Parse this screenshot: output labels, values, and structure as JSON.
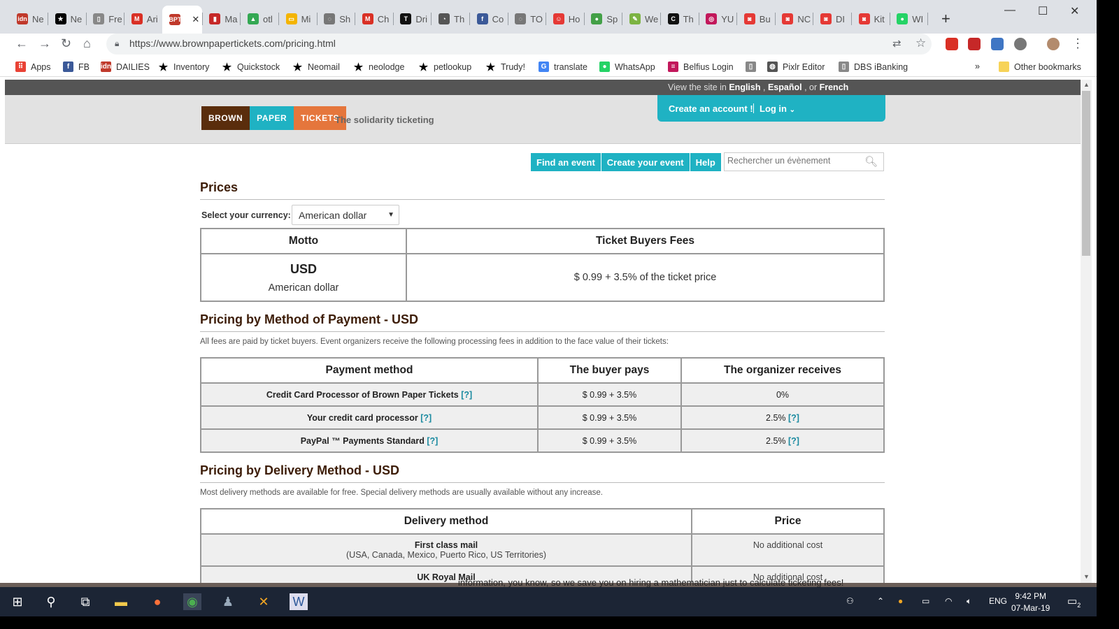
{
  "browser": {
    "tabs": [
      {
        "label": "Ne",
        "color": "#c0392b",
        "glyph": "idn"
      },
      {
        "label": "Ne",
        "color": "#000",
        "glyph": "★"
      },
      {
        "label": "Fre",
        "color": "#888",
        "glyph": "▯"
      },
      {
        "label": "Ari",
        "color": "#d93025",
        "glyph": "M"
      },
      {
        "label": "",
        "color": "#c0392b",
        "glyph": "BPT",
        "active": true
      },
      {
        "label": "Ma",
        "color": "#c62828",
        "glyph": "▮"
      },
      {
        "label": "otl",
        "color": "#34a853",
        "glyph": "▲"
      },
      {
        "label": "Mi",
        "color": "#f4b400",
        "glyph": "▭"
      },
      {
        "label": "Sh",
        "color": "#777",
        "glyph": "◌"
      },
      {
        "label": "Ch",
        "color": "#d93025",
        "glyph": "M"
      },
      {
        "label": "Dri",
        "color": "#111",
        "glyph": "T"
      },
      {
        "label": "Th",
        "color": "#555",
        "glyph": "◔"
      },
      {
        "label": "Co",
        "color": "#3b5998",
        "glyph": "f"
      },
      {
        "label": "TO",
        "color": "#777",
        "glyph": "◌"
      },
      {
        "label": "Ho",
        "color": "#e53935",
        "glyph": "☺"
      },
      {
        "label": "Sp",
        "color": "#43a047",
        "glyph": "●"
      },
      {
        "label": "We",
        "color": "#7cb342",
        "glyph": "✎"
      },
      {
        "label": "Th",
        "color": "#111",
        "glyph": "C"
      },
      {
        "label": "YU",
        "color": "#c2185b",
        "glyph": "◎"
      },
      {
        "label": "Bu",
        "color": "#e53935",
        "glyph": "◙"
      },
      {
        "label": "NC",
        "color": "#e53935",
        "glyph": "◙"
      },
      {
        "label": "DI",
        "color": "#e53935",
        "glyph": "◙"
      },
      {
        "label": "Kit",
        "color": "#e53935",
        "glyph": "◙"
      },
      {
        "label": "WI",
        "color": "#25d366",
        "glyph": "●"
      }
    ],
    "url": "https://www.brownpapertickets.com/pricing.html",
    "bookmarks": [
      {
        "label": "Apps",
        "color": "#e94235",
        "glyph": "⠿"
      },
      {
        "label": "FB",
        "color": "#3b5998",
        "glyph": "f"
      },
      {
        "label": "DAILIES",
        "color": "#c0392b",
        "glyph": "idn"
      },
      {
        "label": "Inventory",
        "color": "#000",
        "glyph": "★"
      },
      {
        "label": "Quickstock",
        "color": "#000",
        "glyph": "★"
      },
      {
        "label": "Neomail",
        "color": "#000",
        "glyph": "★"
      },
      {
        "label": "neolodge",
        "color": "#000",
        "glyph": "★"
      },
      {
        "label": "petlookup",
        "color": "#000",
        "glyph": "★"
      },
      {
        "label": "Trudy!",
        "color": "#000",
        "glyph": "★"
      },
      {
        "label": "translate",
        "color": "#4285f4",
        "glyph": "G"
      },
      {
        "label": "WhatsApp",
        "color": "#25d366",
        "glyph": "●"
      },
      {
        "label": "Belfius Login",
        "color": "#c2185b",
        "glyph": "≡"
      },
      {
        "label": "",
        "color": "#888",
        "glyph": "▯"
      },
      {
        "label": "Pixlr Editor",
        "color": "#555",
        "glyph": "◍"
      },
      {
        "label": "DBS iBanking",
        "color": "#888",
        "glyph": "▯"
      }
    ],
    "bookmarks_overflow": "»",
    "other_bookmarks": "Other bookmarks"
  },
  "site": {
    "lang_prefix": "View the site in",
    "lang_english": "English",
    "lang_comma": ",",
    "lang_espanol": "Español",
    "lang_or": ", or",
    "lang_french": "French",
    "logo": [
      "BROWN",
      "PAPER",
      "TICKETS"
    ],
    "tagline": "The solidarity ticketing",
    "create_account": "Create an account !",
    "login": "Log in",
    "nav": [
      "Find an event",
      "Create your event",
      "Help"
    ],
    "search_placeholder": "Rechercher un évènement",
    "prices_title": "Prices",
    "currency_label": "Select your currency:",
    "currency_value": "American dollar",
    "motto_table": {
      "headers": [
        "Motto",
        "Ticket Buyers Fees"
      ],
      "code": "USD",
      "name": "American dollar",
      "fee": "$ 0.99 + 3.5% of the ticket price"
    },
    "payment_title": "Pricing by Method of Payment - USD",
    "payment_note": "All fees are paid by ticket buyers. Event organizers receive the following processing fees in addition to the face value of their tickets:",
    "payment_table": {
      "headers": [
        "Payment method",
        "The buyer pays",
        "The organizer receives"
      ],
      "rows": [
        {
          "method": "Credit Card Processor of Brown Paper Tickets",
          "buyer": "$ 0.99 + 3.5%",
          "org": "0%"
        },
        {
          "method": "Your credit card processor",
          "buyer": "$ 0.99 + 3.5%",
          "org": "2.5%"
        },
        {
          "method": "PayPal ™ Payments Standard",
          "buyer": "$ 0.99 + 3.5%",
          "org": "2.5%"
        }
      ],
      "help": "[?]"
    },
    "delivery_title": "Pricing by Delivery Method - USD",
    "delivery_note": "Most delivery methods are available for free. Special delivery methods are usually available without any increase.",
    "delivery_table": {
      "headers": [
        "Delivery method",
        "Price"
      ],
      "rows": [
        {
          "method": "First class mail",
          "sub": "(USA, Canada, Mexico, Puerto Rico, US Territories)",
          "price": "No additional cost"
        },
        {
          "method": "UK Royal Mail",
          "sub": "",
          "price": "No additional cost"
        }
      ]
    },
    "background_text": "information, you know, so we save you on hiring a mathematician just to calculate ticketing fees!"
  },
  "taskbar": {
    "lang": "ENG",
    "time": "9:42 PM",
    "date": "07-Mar-19",
    "notifications": "2"
  }
}
